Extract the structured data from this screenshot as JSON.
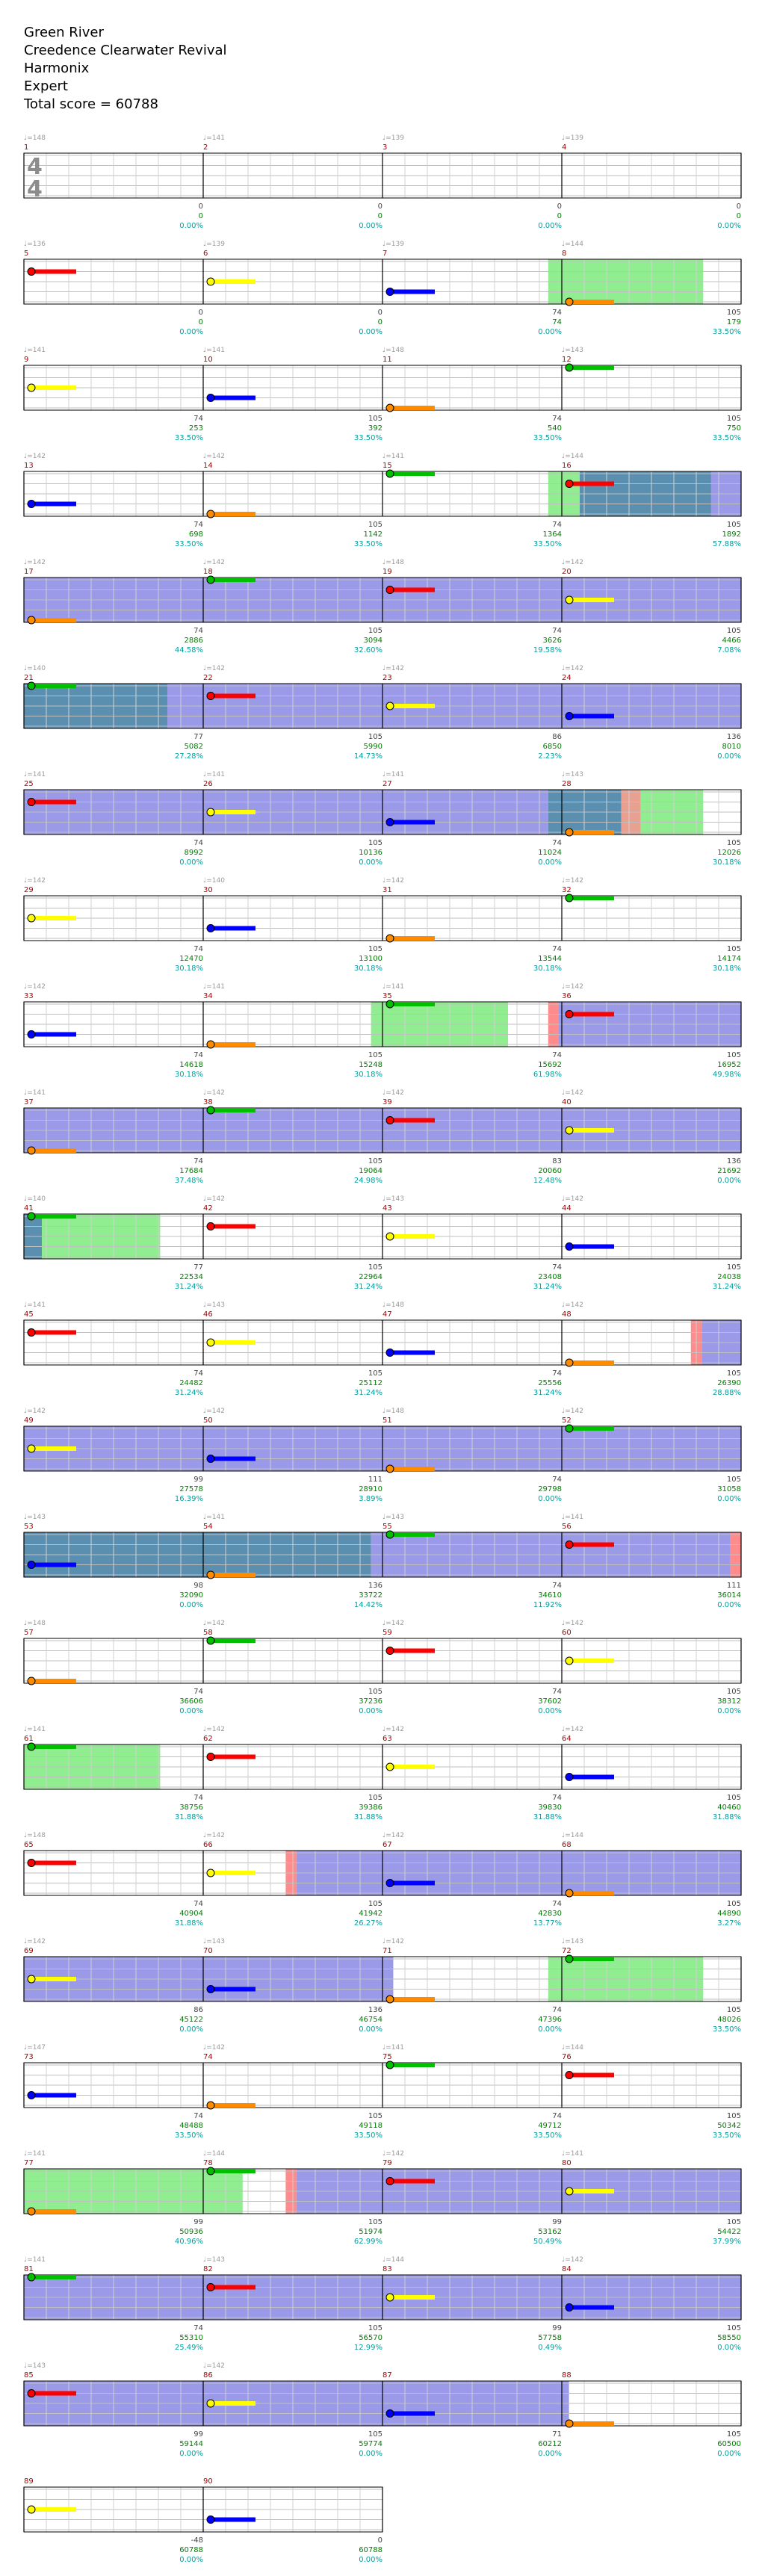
{
  "header": {
    "song": "Green River",
    "artist": "Creedence Clearwater Revival",
    "charter": "Harmonix",
    "difficulty": "Expert",
    "total_score": "Total score = 60788"
  },
  "time_signature": [
    "4",
    "4"
  ],
  "colors": {
    "green": "#00c000",
    "red": "#ff0000",
    "yellow": "#ffff00",
    "blue": "#0000ff",
    "orange": "#ff8c00",
    "overdrive_fill": "#9a9ae8",
    "solo_fill": "#90ee90",
    "overlap_fill": "#5a8fb0",
    "measure_number": "#b00000",
    "tempo": "#9a9a9a",
    "score": "#008000",
    "percent": "#00a0a0"
  },
  "rows": [
    {
      "m": [
        1,
        2,
        3,
        4
      ],
      "t": [
        "♩=148",
        "♩=141",
        "♩=139",
        "♩=139"
      ],
      "v": [
        "0",
        "0",
        "0",
        "0"
      ],
      "s": [
        "0",
        "0",
        "0",
        "0"
      ],
      "p": [
        "0.00%",
        "0.00%",
        "0.00%",
        "0.00%"
      ]
    },
    {
      "m": [
        5,
        6,
        7,
        8
      ],
      "t": [
        "♩=136",
        "♩=139",
        "♩=139",
        "♩=144"
      ],
      "v": [
        "0",
        "0",
        "74",
        "105"
      ],
      "s": [
        "0",
        "0",
        "74",
        "179"
      ],
      "p": [
        "0.00%",
        "0.00%",
        "0.00%",
        "33.50%"
      ]
    },
    {
      "m": [
        9,
        10,
        11,
        12
      ],
      "t": [
        "♩=141",
        "♩=141",
        "♩=148",
        "♩=143"
      ],
      "v": [
        "74",
        "105",
        "74",
        "105"
      ],
      "s": [
        "253",
        "392",
        "540",
        "750"
      ],
      "p": [
        "33.50%",
        "33.50%",
        "33.50%",
        "33.50%"
      ]
    },
    {
      "m": [
        13,
        14,
        15,
        16
      ],
      "t": [
        "♩=142",
        "♩=142",
        "♩=141",
        "♩=144"
      ],
      "v": [
        "74",
        "105",
        "74",
        "105"
      ],
      "s": [
        "698",
        "1142",
        "1364",
        "1892"
      ],
      "p": [
        "33.50%",
        "33.50%",
        "33.50%",
        "57.88%"
      ]
    },
    {
      "m": [
        17,
        18,
        19,
        20
      ],
      "t": [
        "♩=142",
        "♩=142",
        "♩=148",
        "♩=142"
      ],
      "v": [
        "74",
        "105",
        "74",
        "105"
      ],
      "s": [
        "2886",
        "3094",
        "3626",
        "4466"
      ],
      "p": [
        "44.58%",
        "32.60%",
        "19.58%",
        "7.08%"
      ]
    },
    {
      "m": [
        21,
        22,
        23,
        24
      ],
      "t": [
        "♩=140",
        "♩=142",
        "♩=142",
        "♩=142"
      ],
      "v": [
        "77",
        "105",
        "86",
        "136"
      ],
      "s": [
        "5082",
        "5990",
        "6850",
        "8010"
      ],
      "p": [
        "27.28%",
        "14.73%",
        "2.23%",
        "0.00%"
      ]
    },
    {
      "m": [
        25,
        26,
        27,
        28
      ],
      "t": [
        "♩=141",
        "♩=141",
        "♩=141",
        "♩=143"
      ],
      "v": [
        "74",
        "105",
        "74",
        "105"
      ],
      "s": [
        "8992",
        "10136",
        "11024",
        "12026"
      ],
      "p": [
        "0.00%",
        "0.00%",
        "0.00%",
        "30.18%"
      ]
    },
    {
      "m": [
        29,
        30,
        31,
        32
      ],
      "t": [
        "♩=142",
        "♩=140",
        "♩=142",
        "♩=142"
      ],
      "v": [
        "74",
        "105",
        "74",
        "105"
      ],
      "s": [
        "12470",
        "13100",
        "13544",
        "14174"
      ],
      "p": [
        "30.18%",
        "30.18%",
        "30.18%",
        "30.18%"
      ]
    },
    {
      "m": [
        33,
        34,
        35,
        36
      ],
      "t": [
        "♩=142",
        "♩=141",
        "♩=141",
        "♩=142"
      ],
      "v": [
        "74",
        "105",
        "74",
        "105"
      ],
      "s": [
        "14618",
        "15248",
        "15692",
        "16952"
      ],
      "p": [
        "30.18%",
        "30.18%",
        "61.98%",
        "49.98%"
      ]
    },
    {
      "m": [
        37,
        38,
        39,
        40
      ],
      "t": [
        "♩=141",
        "♩=142",
        "♩=142",
        "♩=142"
      ],
      "v": [
        "74",
        "105",
        "83",
        "136"
      ],
      "s": [
        "17684",
        "19064",
        "20060",
        "21692"
      ],
      "p": [
        "37.48%",
        "24.98%",
        "12.48%",
        "0.00%"
      ]
    },
    {
      "m": [
        41,
        42,
        43,
        44
      ],
      "t": [
        "♩=140",
        "♩=142",
        "♩=143",
        "♩=142"
      ],
      "v": [
        "77",
        "105",
        "74",
        "105"
      ],
      "s": [
        "22534",
        "22964",
        "23408",
        "24038"
      ],
      "p": [
        "31.24%",
        "31.24%",
        "31.24%",
        "31.24%"
      ]
    },
    {
      "m": [
        45,
        46,
        47,
        48
      ],
      "t": [
        "♩=141",
        "♩=143",
        "♩=148",
        "♩=142"
      ],
      "v": [
        "74",
        "105",
        "74",
        "105"
      ],
      "s": [
        "24482",
        "25112",
        "25556",
        "26390"
      ],
      "p": [
        "31.24%",
        "31.24%",
        "31.24%",
        "28.88%"
      ]
    },
    {
      "m": [
        49,
        50,
        51,
        52
      ],
      "t": [
        "♩=142",
        "♩=142",
        "♩=148",
        "♩=142"
      ],
      "v": [
        "99",
        "111",
        "74",
        "105"
      ],
      "s": [
        "27578",
        "28910",
        "29798",
        "31058"
      ],
      "p": [
        "16.39%",
        "3.89%",
        "0.00%",
        "0.00%"
      ]
    },
    {
      "m": [
        53,
        54,
        55,
        56
      ],
      "t": [
        "♩=143",
        "♩=141",
        "♩=143",
        "♩=141"
      ],
      "v": [
        "98",
        "136",
        "74",
        "111"
      ],
      "s": [
        "32090",
        "33722",
        "34610",
        "36014"
      ],
      "p": [
        "0.00%",
        "14.42%",
        "11.92%",
        "0.00%"
      ]
    },
    {
      "m": [
        57,
        58,
        59,
        60
      ],
      "t": [
        "♩=148",
        "♩=142",
        "♩=142",
        "♩=142"
      ],
      "v": [
        "74",
        "105",
        "74",
        "105"
      ],
      "s": [
        "36606",
        "37236",
        "37602",
        "38312"
      ],
      "p": [
        "0.00%",
        "0.00%",
        "0.00%",
        "0.00%"
      ]
    },
    {
      "m": [
        61,
        62,
        63,
        64
      ],
      "t": [
        "♩=141",
        "♩=142",
        "♩=142",
        "♩=142"
      ],
      "v": [
        "74",
        "105",
        "74",
        "105"
      ],
      "s": [
        "38756",
        "39386",
        "39830",
        "40460"
      ],
      "p": [
        "31.88%",
        "31.88%",
        "31.88%",
        "31.88%"
      ]
    },
    {
      "m": [
        65,
        66,
        67,
        68
      ],
      "t": [
        "♩=148",
        "♩=142",
        "♩=142",
        "♩=144"
      ],
      "v": [
        "74",
        "105",
        "74",
        "105"
      ],
      "s": [
        "40904",
        "41942",
        "42830",
        "44890"
      ],
      "p": [
        "31.88%",
        "26.27%",
        "13.77%",
        "3.27%"
      ]
    },
    {
      "m": [
        69,
        70,
        71,
        72
      ],
      "t": [
        "♩=142",
        "♩=143",
        "♩=142",
        "♩=143"
      ],
      "v": [
        "86",
        "136",
        "74",
        "105"
      ],
      "s": [
        "45122",
        "46754",
        "47396",
        "48026"
      ],
      "p": [
        "0.00%",
        "0.00%",
        "0.00%",
        "33.50%"
      ]
    },
    {
      "m": [
        73,
        74,
        75,
        76
      ],
      "t": [
        "♩=147",
        "♩=142",
        "♩=141",
        "♩=144"
      ],
      "v": [
        "74",
        "105",
        "74",
        "105"
      ],
      "s": [
        "48488",
        "49118",
        "49712",
        "50342"
      ],
      "p": [
        "33.50%",
        "33.50%",
        "33.50%",
        "33.50%"
      ]
    },
    {
      "m": [
        77,
        78,
        79,
        80
      ],
      "t": [
        "♩=141",
        "♩=144",
        "♩=142",
        "♩=141"
      ],
      "v": [
        "99",
        "105",
        "99",
        "105"
      ],
      "s": [
        "50936",
        "51974",
        "53162",
        "54422"
      ],
      "p": [
        "40.96%",
        "62.99%",
        "50.49%",
        "37.99%"
      ]
    },
    {
      "m": [
        81,
        82,
        83,
        84
      ],
      "t": [
        "♩=141",
        "♩=143",
        "♩=144",
        "♩=142"
      ],
      "v": [
        "74",
        "105",
        "99",
        "105"
      ],
      "s": [
        "55310",
        "56570",
        "57758",
        "58550"
      ],
      "p": [
        "25.49%",
        "12.99%",
        "0.49%",
        "0.00%"
      ]
    },
    {
      "m": [
        85,
        86,
        87,
        88
      ],
      "t": [
        "♩=143",
        "♩=142",
        "",
        ""
      ],
      "v": [
        "99",
        "105",
        "71",
        "105"
      ],
      "s": [
        "59144",
        "59774",
        "60212",
        "60500"
      ],
      "p": [
        "0.00%",
        "0.00%",
        "0.00%",
        "0.00%"
      ]
    },
    {
      "m": [
        89,
        90
      ],
      "t": [
        "",
        ""
      ],
      "v": [
        "-48",
        "0"
      ],
      "s": [
        "60788",
        "60788"
      ],
      "p": [
        "0.00%",
        "0.00%"
      ]
    }
  ]
}
